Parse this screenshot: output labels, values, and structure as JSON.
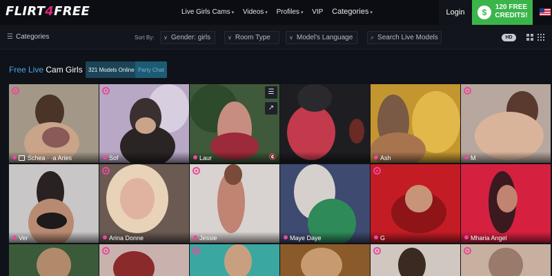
{
  "brand": {
    "logo_pre": "FLIRT",
    "logo_four": "4",
    "logo_post": "FREE"
  },
  "nav": {
    "items": [
      {
        "label": "Live Girls Cams",
        "caret": "▾"
      },
      {
        "label": "Videos",
        "caret": "▾"
      },
      {
        "label": "Profiles",
        "caret": "▾"
      },
      {
        "label": "VIP",
        "caret": ""
      },
      {
        "label": "Categories",
        "caret": "▾"
      }
    ],
    "login": "Login",
    "credits_line1": "120 FREE",
    "credits_line2": "CREDITS!",
    "flag_icon": "us-flag-icon"
  },
  "filters": {
    "categories_label": "Categories",
    "sort_by": "Sort By:",
    "gender": "Gender: girls",
    "room_type": "Room Type",
    "language": "Model's Language",
    "search_placeholder": "Search Live Models",
    "hd": "HD"
  },
  "section": {
    "title_free": "Free Live",
    "title_rest": " Cam Girls",
    "models_online": "321 Models Online",
    "party_chat": "Party Chat"
  },
  "models": [
    {
      "name": "Schea · ·a Aries",
      "scheduled": true
    },
    {
      "name": "Sof",
      "scheduled": false
    },
    {
      "name": "Laur",
      "scheduled": false
    },
    {
      "name": "",
      "scheduled": false
    },
    {
      "name": "Ash",
      "scheduled": false
    },
    {
      "name": "M",
      "scheduled": false
    },
    {
      "name": "Ver",
      "scheduled": false
    },
    {
      "name": "Arina Donne",
      "scheduled": false
    },
    {
      "name": "Jessie",
      "scheduled": false
    },
    {
      "name": "Maye Daye",
      "scheduled": false
    },
    {
      "name": "G",
      "scheduled": false
    },
    {
      "name": "Mharia Angel",
      "scheduled": false
    }
  ],
  "colors": {
    "accent_pink": "#e94a9a",
    "credits_green": "#3ab54a",
    "title_blue": "#4aa7e6",
    "badge_teal": "#1b4557"
  }
}
